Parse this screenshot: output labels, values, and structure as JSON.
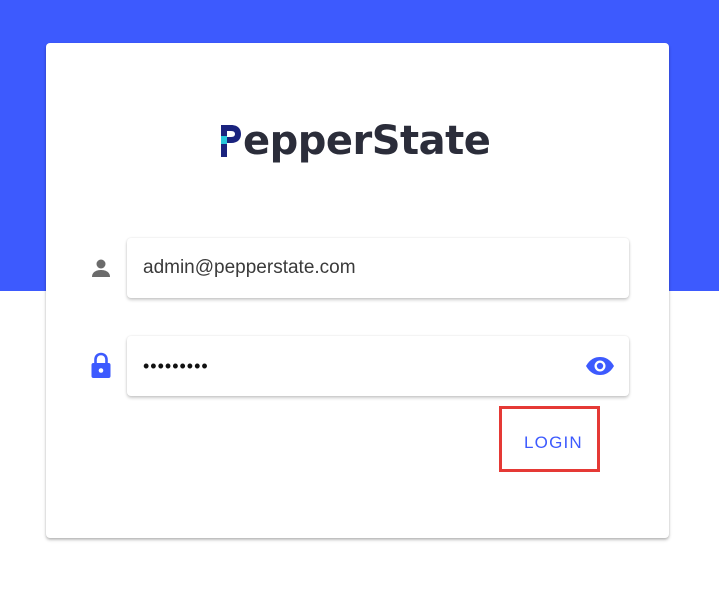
{
  "theme": {
    "accent": "#3d5afe",
    "background": "#ffffff",
    "text": "#2b2d3a",
    "icon_gray": "#6b6b6b",
    "highlight": "#e53935"
  },
  "brand": {
    "logo_initial": "P",
    "logo_rest": "epperState",
    "logo_colors": [
      "#1a237e",
      "#2b2d3a",
      "#26c6da"
    ]
  },
  "login_form": {
    "email": {
      "icon": "person-icon",
      "value": "admin@pepperstate.com",
      "type": "email"
    },
    "password": {
      "icon": "lock-icon",
      "value": "•••••••••",
      "type": "password",
      "toggle_icon": "eye-icon"
    },
    "submit_label": "LOGIN"
  }
}
